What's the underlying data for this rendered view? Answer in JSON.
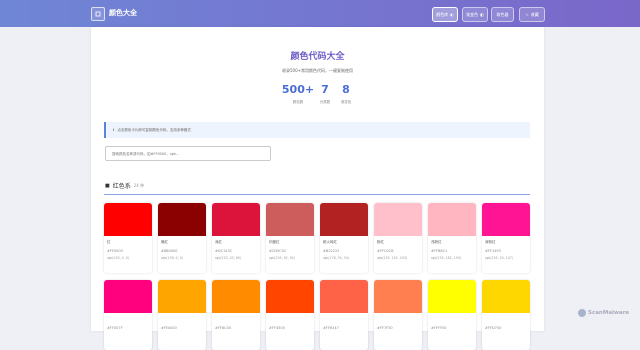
{
  "header": {
    "logo_text": "颜色大全",
    "nav": [
      {
        "label": "颜色库",
        "icon": "palette-icon",
        "active": true
      },
      {
        "label": "渐变色",
        "icon": "gradient-icon",
        "active": false
      },
      {
        "label": "取色器",
        "icon": "",
        "active": false
      },
      {
        "label": "收藏",
        "icon": "star-icon",
        "active": false
      }
    ]
  },
  "hero": {
    "title": "颜色代码大全",
    "subtitle": "收录500+常用颜色代码，一键复制使用",
    "stats": [
      {
        "value": "500+",
        "label": "颜色数"
      },
      {
        "value": "7",
        "label": "分类数"
      },
      {
        "value": "8",
        "label": "渐变色"
      }
    ]
  },
  "tip": {
    "text": "点击颜色卡片即可复制颜色代码，支持多种格式"
  },
  "search": {
    "placeholder": "搜索颜色名称或代码，如#FF0000、rgb..."
  },
  "section": {
    "title": "红色系",
    "count": "24 种"
  },
  "colors": [
    {
      "name": "红",
      "hex": "#FF0000",
      "rgb": "rgb(255, 0, 0)",
      "color": "#FF0000"
    },
    {
      "name": "暗红",
      "hex": "#8B0000",
      "rgb": "rgb(139, 0, 0)",
      "color": "#8B0000"
    },
    {
      "name": "深红",
      "hex": "#DC143C",
      "rgb": "rgb(220, 20, 60)",
      "color": "#DC143C"
    },
    {
      "name": "印度红",
      "hex": "#CD5C5C",
      "rgb": "rgb(205, 92, 92)",
      "color": "#CD5C5C"
    },
    {
      "name": "耐火砖红",
      "hex": "#B22222",
      "rgb": "rgb(178, 34, 34)",
      "color": "#B22222"
    },
    {
      "name": "粉红",
      "hex": "#FFC0CB",
      "rgb": "rgb(255, 192, 203)",
      "color": "#FFC0CB"
    },
    {
      "name": "浅粉红",
      "hex": "#FFB6C1",
      "rgb": "rgb(255, 182, 193)",
      "color": "#FFB6C1"
    },
    {
      "name": "深粉红",
      "hex": "#FF1493",
      "rgb": "rgb(255, 20, 147)",
      "color": "#FF1493"
    },
    {
      "name": "",
      "hex": "#FF007F",
      "rgb": "",
      "color": "#FF007F"
    },
    {
      "name": "",
      "hex": "#FFA500",
      "rgb": "",
      "color": "#FFA500"
    },
    {
      "name": "",
      "hex": "#FF8C00",
      "rgb": "",
      "color": "#FF8C00"
    },
    {
      "name": "",
      "hex": "#FF4500",
      "rgb": "",
      "color": "#FF4500"
    },
    {
      "name": "",
      "hex": "#FF6347",
      "rgb": "",
      "color": "#FF6347"
    },
    {
      "name": "",
      "hex": "#FF7F50",
      "rgb": "",
      "color": "#FF7F50"
    },
    {
      "name": "",
      "hex": "#FFFF00",
      "rgb": "",
      "color": "#FFFF00"
    },
    {
      "name": "",
      "hex": "#FFD700",
      "rgb": "",
      "color": "#FFD700"
    }
  ],
  "watermark": {
    "text": "ScanMalware"
  }
}
